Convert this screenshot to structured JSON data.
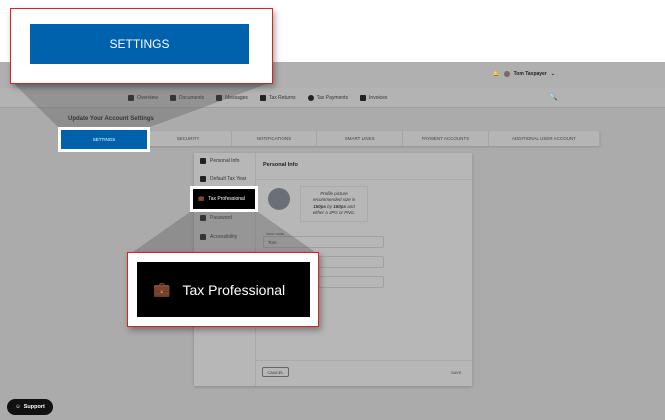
{
  "header": {
    "user_name": "Tom Taxpayer"
  },
  "nav": [
    "Overview",
    "Documents",
    "Messages",
    "Tax Returns",
    "Tax Payments",
    "Invoices"
  ],
  "page_title": "Update Your Account Settings",
  "tabs": [
    "SETTINGS",
    "SECURITY",
    "NOTIFICATIONS",
    "SMART LINKS",
    "PAYMENT ACCOUNTS",
    "ADDITIONAL USER ACCOUNT"
  ],
  "menu": [
    "Personal Info",
    "Default Tax Year",
    "Tax Professional",
    "Password",
    "Accessibility"
  ],
  "panel": {
    "title": "Personal Info",
    "profile_hint_1": "Profile picture recommended size is ",
    "bold1": "150px",
    "mid": " by ",
    "bold2": "150px",
    "profile_hint_2": " and either a JPG or PNG.",
    "first_name_label": "FIRST NAME",
    "first_name_value": "Tom",
    "cancel": "CANCEL",
    "save": "SAVE"
  },
  "support": "Support",
  "callouts": {
    "settings": "SETTINGS",
    "tax_professional": "Tax Professional"
  },
  "colors": {
    "accent": "#0062ad",
    "highlight_border": "#e0201c"
  }
}
